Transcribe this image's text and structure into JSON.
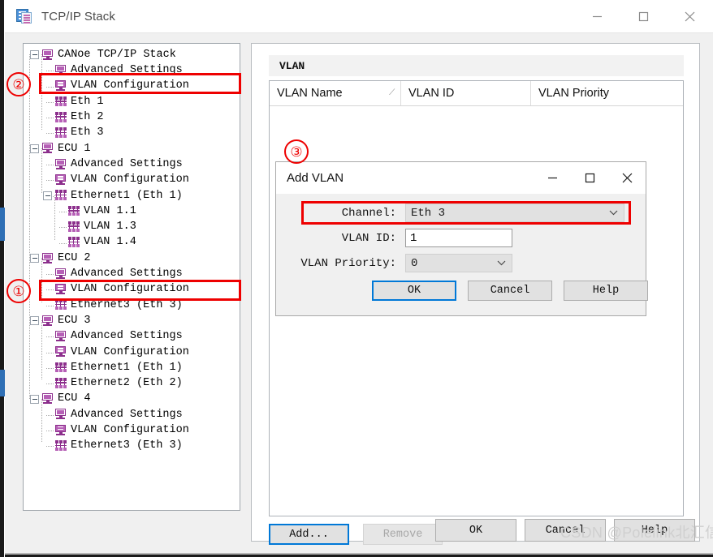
{
  "window": {
    "title": "TCP/IP Stack",
    "icon": "app-stack-icon",
    "controls": {
      "minimize": "—",
      "maximize": "□",
      "close": "✕"
    }
  },
  "tree": {
    "nodes": [
      {
        "label": "CANoe TCP/IP Stack",
        "icon": "node-icon",
        "depth": 0,
        "expander": "collapse"
      },
      {
        "label": "Advanced Settings",
        "icon": "node-icon",
        "depth": 1,
        "expander": "none"
      },
      {
        "label": "VLAN Configuration",
        "icon": "vlan-icon",
        "depth": 1,
        "expander": "none"
      },
      {
        "label": "Eth 1",
        "icon": "net-icon",
        "depth": 1,
        "expander": "none"
      },
      {
        "label": "Eth 2",
        "icon": "net-icon",
        "depth": 1,
        "expander": "none"
      },
      {
        "label": "Eth 3",
        "icon": "net-icon",
        "depth": 1,
        "expander": "none"
      },
      {
        "label": "ECU 1",
        "icon": "node-icon",
        "depth": 0,
        "expander": "collapse"
      },
      {
        "label": "Advanced Settings",
        "icon": "node-icon",
        "depth": 1,
        "expander": "none"
      },
      {
        "label": "VLAN Configuration",
        "icon": "vlan-icon",
        "depth": 1,
        "expander": "none"
      },
      {
        "label": "Ethernet1 (Eth 1)",
        "icon": "net-icon",
        "depth": 1,
        "expander": "collapse"
      },
      {
        "label": "VLAN 1.1",
        "icon": "net-icon",
        "depth": 2,
        "expander": "none"
      },
      {
        "label": "VLAN 1.3",
        "icon": "net-icon",
        "depth": 2,
        "expander": "none"
      },
      {
        "label": "VLAN 1.4",
        "icon": "net-icon",
        "depth": 2,
        "expander": "none"
      },
      {
        "label": "ECU 2",
        "icon": "node-icon",
        "depth": 0,
        "expander": "collapse"
      },
      {
        "label": "Advanced Settings",
        "icon": "node-icon",
        "depth": 1,
        "expander": "none"
      },
      {
        "label": "VLAN Configuration",
        "icon": "vlan-icon",
        "depth": 1,
        "expander": "none"
      },
      {
        "label": "Ethernet3 (Eth 3)",
        "icon": "net-icon",
        "depth": 1,
        "expander": "none"
      },
      {
        "label": "ECU 3",
        "icon": "node-icon",
        "depth": 0,
        "expander": "collapse"
      },
      {
        "label": "Advanced Settings",
        "icon": "node-icon",
        "depth": 1,
        "expander": "none"
      },
      {
        "label": "VLAN Configuration",
        "icon": "vlan-icon",
        "depth": 1,
        "expander": "none"
      },
      {
        "label": "Ethernet1 (Eth 1)",
        "icon": "net-icon",
        "depth": 1,
        "expander": "none"
      },
      {
        "label": "Ethernet2 (Eth 2)",
        "icon": "net-icon",
        "depth": 1,
        "expander": "none"
      },
      {
        "label": "ECU 4",
        "icon": "node-icon",
        "depth": 0,
        "expander": "collapse"
      },
      {
        "label": "Advanced Settings",
        "icon": "node-icon",
        "depth": 1,
        "expander": "none"
      },
      {
        "label": "VLAN Configuration",
        "icon": "vlan-icon",
        "depth": 1,
        "expander": "none"
      },
      {
        "label": "Ethernet3 (Eth 3)",
        "icon": "net-icon",
        "depth": 1,
        "expander": "none"
      }
    ]
  },
  "right_panel": {
    "group_title": "VLAN",
    "columns": [
      {
        "label": "VLAN Name",
        "sort_indicator": "⁄"
      },
      {
        "label": "VLAN ID",
        "sort_indicator": ""
      },
      {
        "label": "VLAN Priority",
        "sort_indicator": ""
      }
    ],
    "rows": [],
    "add_label": "Add...",
    "remove_label": "Remove",
    "remove_disabled": true
  },
  "footer": {
    "ok": "OK",
    "cancel": "Cancel",
    "help": "Help"
  },
  "dialog": {
    "title": "Add VLAN",
    "controls": {
      "minimize": "—",
      "maximize": "□",
      "close": "✕"
    },
    "fields": {
      "channel_label": "Channel:",
      "channel_value": "Eth 3",
      "vlan_id_label": "VLAN ID:",
      "vlan_id_value": "1",
      "priority_label": "VLAN Priority:",
      "priority_value": "0"
    },
    "buttons": {
      "ok": "OK",
      "cancel": "Cancel",
      "help": "Help"
    }
  },
  "annotations": {
    "marker_1": "①",
    "marker_2": "②",
    "marker_3": "③",
    "color": "#ee0000"
  },
  "watermark": "CSDN @Polelink北汇信息"
}
